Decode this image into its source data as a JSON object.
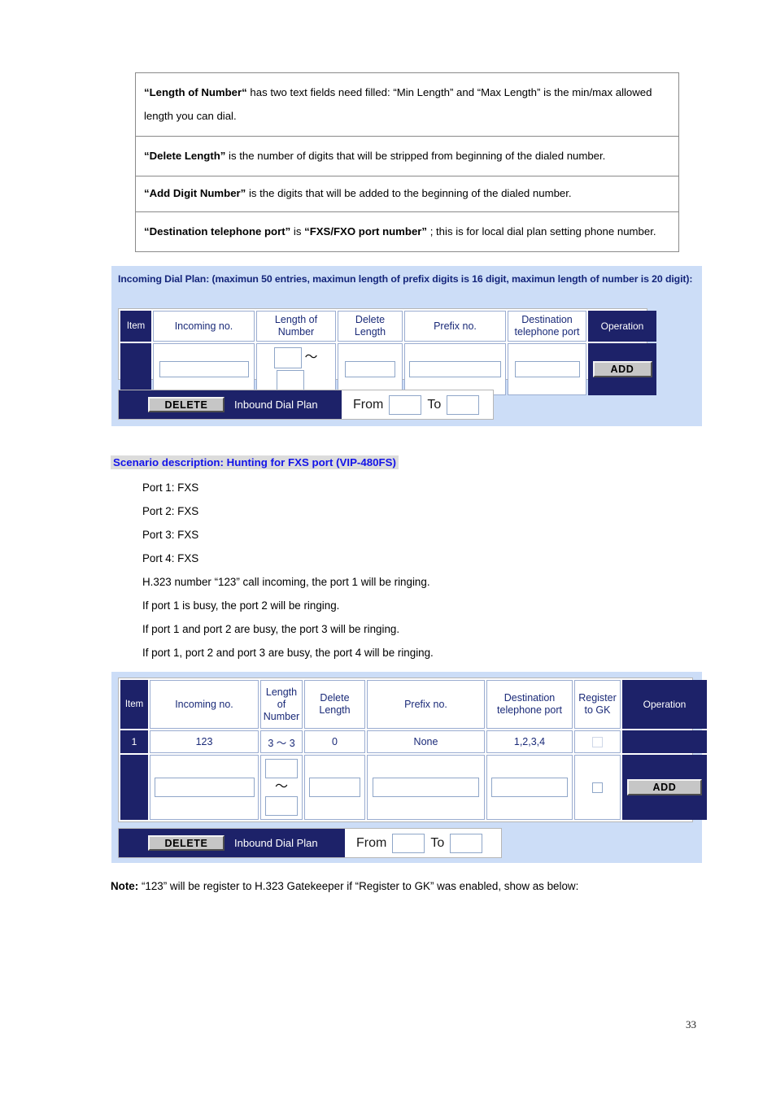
{
  "definitions": [
    {
      "id": "length-of-number",
      "term": "“Length of Number“",
      "rest": " has two text fields need filled: “Min Length” and “Max Length” is the min/max allowed length you can dial."
    },
    {
      "id": "delete-length",
      "term": "“Delete Length”",
      "rest": " is the number of digits that will be stripped from beginning of the dialed number."
    },
    {
      "id": "add-digit-number",
      "term": "“Add Digit Number”",
      "rest": " is the digits that will be added to the beginning of the dialed number."
    },
    {
      "id": "destination-telephone-port",
      "term": "“Destination telephone port”",
      "mid": " is ",
      "term2": "“FXS/FXO port number”",
      "rest": " ; this is for local dial plan setting phone number."
    }
  ],
  "incoming_panel": {
    "title": "Incoming Dial Plan: (maximun 50 entries, maximun length of prefix digits is 16 digit, maximun length of number is 20 digit):",
    "headers": {
      "item": "Item",
      "incoming_no": "Incoming no.",
      "length_of_number": "Length of Number",
      "delete_length": "Delete Length",
      "prefix_no": "Prefix no.",
      "destination_port": "Destination telephone port",
      "operation": "Operation"
    },
    "tilde": "～",
    "add_button": "ADD",
    "delete_bar": {
      "delete_button": "DELETE",
      "label": "Inbound Dial Plan",
      "from_label": "From",
      "to_label": "To",
      "from_value": "",
      "to_value": ""
    },
    "input_row": {
      "incoming_no": "",
      "min_length": "",
      "max_length": "",
      "delete_length": "",
      "prefix_no": "",
      "destination_port": ""
    }
  },
  "scenario": {
    "heading": "Scenario description: Hunting for FXS port (VIP-480FS)",
    "lines": [
      "Port 1: FXS",
      "Port 2: FXS",
      "Port 3: FXS",
      "Port 4: FXS",
      "H.323 number “123” call incoming, the port 1 will be ringing.",
      "If port 1 is busy, the port 2 will be ringing.",
      "If port 1 and port 2 are busy, the port 3 will be ringing.",
      "If port 1, port 2 and port 3 are busy, the port 4 will be ringing."
    ]
  },
  "scenario_panel": {
    "headers": {
      "item": "Item",
      "incoming_no": "Incoming no.",
      "length_of_number": "Length of Number",
      "delete_length": "Delete Length",
      "prefix_no": "Prefix no.",
      "destination_port": "Destination telephone port",
      "register_to_gk": "Register to GK",
      "operation": "Operation"
    },
    "tilde": "～",
    "add_button": "ADD",
    "rows": [
      {
        "item": "1",
        "incoming_no": "123",
        "length_of_number": "3 ～ 3",
        "delete_length": "0",
        "prefix_no": "None",
        "destination_port": "1,2,3,4",
        "register_to_gk_checked": false
      }
    ],
    "input_row": {
      "incoming_no": "",
      "min_length": "",
      "max_length": "",
      "delete_length": "",
      "prefix_no": "",
      "destination_port": "",
      "register_to_gk_checked": false
    },
    "delete_bar": {
      "delete_button": "DELETE",
      "label": "Inbound Dial Plan",
      "from_label": "From",
      "to_label": "To",
      "from_value": "",
      "to_value": ""
    }
  },
  "note": {
    "prefix": "Note:",
    "text": " “123” will be register to H.323 Gatekeeper if “Register to GK” was enabled, show as below:"
  },
  "page_number": "33",
  "colors": {
    "panel_bg": "#ccddf7",
    "navy": "#1d2269",
    "heading_blue": "#1313e8",
    "title_navy": "#14257a",
    "table_text": "#1a2a78"
  }
}
